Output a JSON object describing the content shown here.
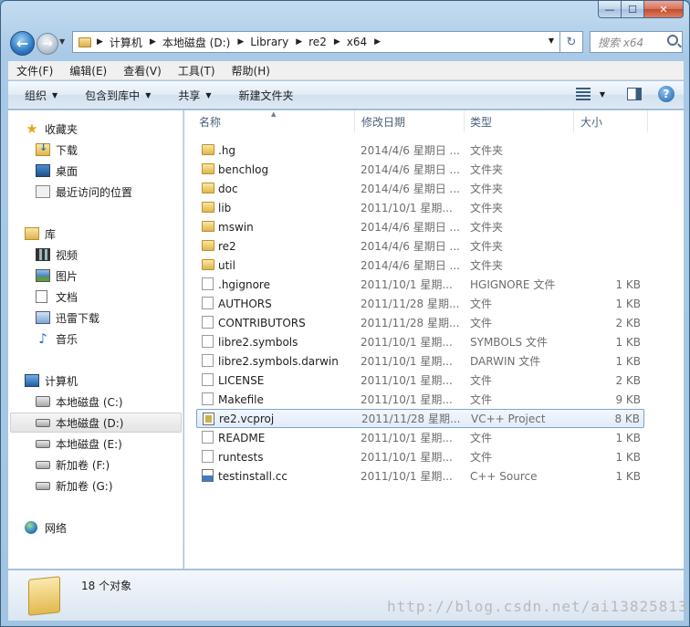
{
  "window": {
    "caption_buttons": {
      "minimize": "—",
      "maximize": "☐",
      "close": "✕"
    }
  },
  "nav": {
    "address_crumbs": [
      "计算机",
      "本地磁盘 (D:)",
      "Library",
      "re2",
      "x64"
    ],
    "search_placeholder": "搜索 x64"
  },
  "menu": [
    "文件(F)",
    "编辑(E)",
    "查看(V)",
    "工具(T)",
    "帮助(H)"
  ],
  "toolbar": {
    "organize": "组织",
    "include_in_library": "包含到库中",
    "share": "共享",
    "new_folder": "新建文件夹"
  },
  "sidebar": {
    "favorites": {
      "label": "收藏夹",
      "items": [
        "下载",
        "桌面",
        "最近访问的位置"
      ]
    },
    "libraries": {
      "label": "库",
      "items": [
        "视频",
        "图片",
        "文档",
        "迅雷下载",
        "音乐"
      ]
    },
    "computer": {
      "label": "计算机",
      "items": [
        "本地磁盘 (C:)",
        "本地磁盘 (D:)",
        "本地磁盘 (E:)",
        "新加卷 (F:)",
        "新加卷 (G:)"
      ],
      "selected": "本地磁盘 (D:)"
    },
    "network": {
      "label": "网络"
    }
  },
  "columns": {
    "name": "名称",
    "date": "修改日期",
    "type": "类型",
    "size": "大小"
  },
  "files": [
    {
      "name": ".hg",
      "date": "2014/4/6 星期日 ...",
      "type": "文件夹",
      "size": "",
      "kind": "folder"
    },
    {
      "name": "benchlog",
      "date": "2014/4/6 星期日 ...",
      "type": "文件夹",
      "size": "",
      "kind": "folder"
    },
    {
      "name": "doc",
      "date": "2014/4/6 星期日 ...",
      "type": "文件夹",
      "size": "",
      "kind": "folder"
    },
    {
      "name": "lib",
      "date": "2011/10/1 星期...",
      "type": "文件夹",
      "size": "",
      "kind": "folder"
    },
    {
      "name": "mswin",
      "date": "2014/4/6 星期日 ...",
      "type": "文件夹",
      "size": "",
      "kind": "folder"
    },
    {
      "name": "re2",
      "date": "2014/4/6 星期日 ...",
      "type": "文件夹",
      "size": "",
      "kind": "folder"
    },
    {
      "name": "util",
      "date": "2014/4/6 星期日 ...",
      "type": "文件夹",
      "size": "",
      "kind": "folder"
    },
    {
      "name": ".hgignore",
      "date": "2011/10/1 星期...",
      "type": "HGIGNORE 文件",
      "size": "1 KB",
      "kind": "file"
    },
    {
      "name": "AUTHORS",
      "date": "2011/11/28 星期...",
      "type": "文件",
      "size": "1 KB",
      "kind": "file"
    },
    {
      "name": "CONTRIBUTORS",
      "date": "2011/11/28 星期...",
      "type": "文件",
      "size": "2 KB",
      "kind": "file"
    },
    {
      "name": "libre2.symbols",
      "date": "2011/10/1 星期...",
      "type": "SYMBOLS 文件",
      "size": "1 KB",
      "kind": "file"
    },
    {
      "name": "libre2.symbols.darwin",
      "date": "2011/10/1 星期...",
      "type": "DARWIN 文件",
      "size": "1 KB",
      "kind": "file"
    },
    {
      "name": "LICENSE",
      "date": "2011/10/1 星期...",
      "type": "文件",
      "size": "2 KB",
      "kind": "file"
    },
    {
      "name": "Makefile",
      "date": "2011/10/1 星期...",
      "type": "文件",
      "size": "9 KB",
      "kind": "file"
    },
    {
      "name": "re2.vcproj",
      "date": "2011/11/28 星期...",
      "type": "VC++ Project",
      "size": "8 KB",
      "kind": "proj",
      "selected": true
    },
    {
      "name": "README",
      "date": "2011/10/1 星期...",
      "type": "文件",
      "size": "1 KB",
      "kind": "file"
    },
    {
      "name": "runtests",
      "date": "2011/10/1 星期...",
      "type": "文件",
      "size": "1 KB",
      "kind": "file"
    },
    {
      "name": "testinstall.cc",
      "date": "2011/10/1 星期...",
      "type": "C++ Source",
      "size": "1 KB",
      "kind": "cpp"
    }
  ],
  "status": {
    "count": "18 个对象"
  },
  "watermark": "http://blog.csdn.net/ai13825813"
}
